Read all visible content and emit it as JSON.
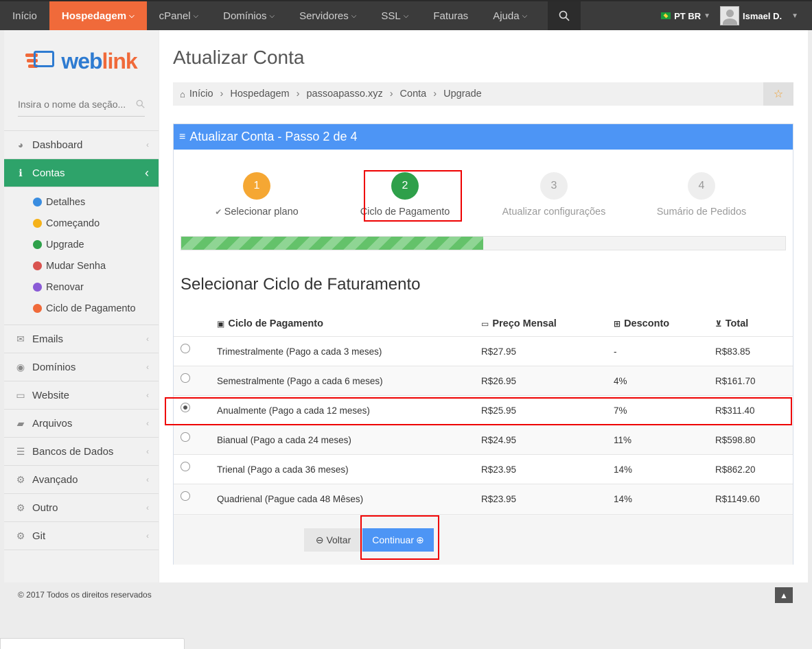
{
  "nav": {
    "items": [
      {
        "label": "Início",
        "caret": false
      },
      {
        "label": "Hospedagem",
        "caret": true,
        "active": true
      },
      {
        "label": "cPanel",
        "caret": true
      },
      {
        "label": "Domínios",
        "caret": true
      },
      {
        "label": "Servidores",
        "caret": true
      },
      {
        "label": "SSL",
        "caret": true
      },
      {
        "label": "Faturas",
        "caret": false
      },
      {
        "label": "Ajuda",
        "caret": true
      }
    ],
    "language": "PT BR",
    "user": "Ismael D."
  },
  "sidebar": {
    "logo_text_a": "web",
    "logo_text_b": "link",
    "search_placeholder": "Insira o nome da seção...",
    "items": [
      {
        "label": "Dashboard"
      },
      {
        "label": "Contas",
        "active": true
      },
      {
        "label": "Emails"
      },
      {
        "label": "Domínios"
      },
      {
        "label": "Website"
      },
      {
        "label": "Arquivos"
      },
      {
        "label": "Bancos de Dados"
      },
      {
        "label": "Avançado"
      },
      {
        "label": "Outro"
      },
      {
        "label": "Git"
      }
    ],
    "sub_items": [
      {
        "label": "Detalhes",
        "color": "#3a8de0"
      },
      {
        "label": "Começando",
        "color": "#f5b21a"
      },
      {
        "label": "Upgrade",
        "color": "#2ea04a"
      },
      {
        "label": "Mudar Senha",
        "color": "#d9534f"
      },
      {
        "label": "Renovar",
        "color": "#8a5bd6"
      },
      {
        "label": "Ciclo de Pagamento",
        "color": "#f06a3a"
      }
    ]
  },
  "main": {
    "page_title": "Atualizar Conta",
    "breadcrumb": [
      "Início",
      "Hospedagem",
      "passoapasso.xyz",
      "Conta",
      "Upgrade"
    ],
    "panel_title": "Atualizar Conta - Passo 2 de 4",
    "steps": [
      {
        "number": "1",
        "label": "Selecionar plano",
        "state": "done",
        "color": "#f5a733"
      },
      {
        "number": "2",
        "label": "Ciclo de Pagamento",
        "state": "current",
        "color": "#2ea04a"
      },
      {
        "number": "3",
        "label": "Atualizar configurações",
        "state": "pending",
        "color": "#eeeeee"
      },
      {
        "number": "4",
        "label": "Sumário de Pedidos",
        "state": "pending",
        "color": "#eeeeee"
      }
    ],
    "progress_percent": 50,
    "section_title": "Selecionar Ciclo de Faturamento",
    "table": {
      "headers": [
        "Ciclo de Pagamento",
        "Preço Mensal",
        "Desconto",
        "Total"
      ],
      "rows": [
        {
          "cycle": "Trimestralmente (Pago a cada 3 meses)",
          "price": "R$27.95",
          "discount": "-",
          "total": "R$83.85",
          "selected": false
        },
        {
          "cycle": "Semestralmente (Pago a cada 6 meses)",
          "price": "R$26.95",
          "discount": "4%",
          "total": "R$161.70",
          "selected": false
        },
        {
          "cycle": "Anualmente (Pago a cada 12 meses)",
          "price": "R$25.95",
          "discount": "7%",
          "total": "R$311.40",
          "selected": true
        },
        {
          "cycle": "Bianual (Pago a cada 24 meses)",
          "price": "R$24.95",
          "discount": "11%",
          "total": "R$598.80",
          "selected": false
        },
        {
          "cycle": "Trienal (Pago a cada 36 meses)",
          "price": "R$23.95",
          "discount": "14%",
          "total": "R$862.20",
          "selected": false
        },
        {
          "cycle": "Quadrienal (Pague cada 48 Mêses)",
          "price": "R$23.95",
          "discount": "14%",
          "total": "R$1149.60",
          "selected": false
        }
      ]
    },
    "back_label": "Voltar",
    "continue_label": "Continuar"
  },
  "footer": {
    "copyright": "© 2017 Todos os direitos reservados"
  }
}
